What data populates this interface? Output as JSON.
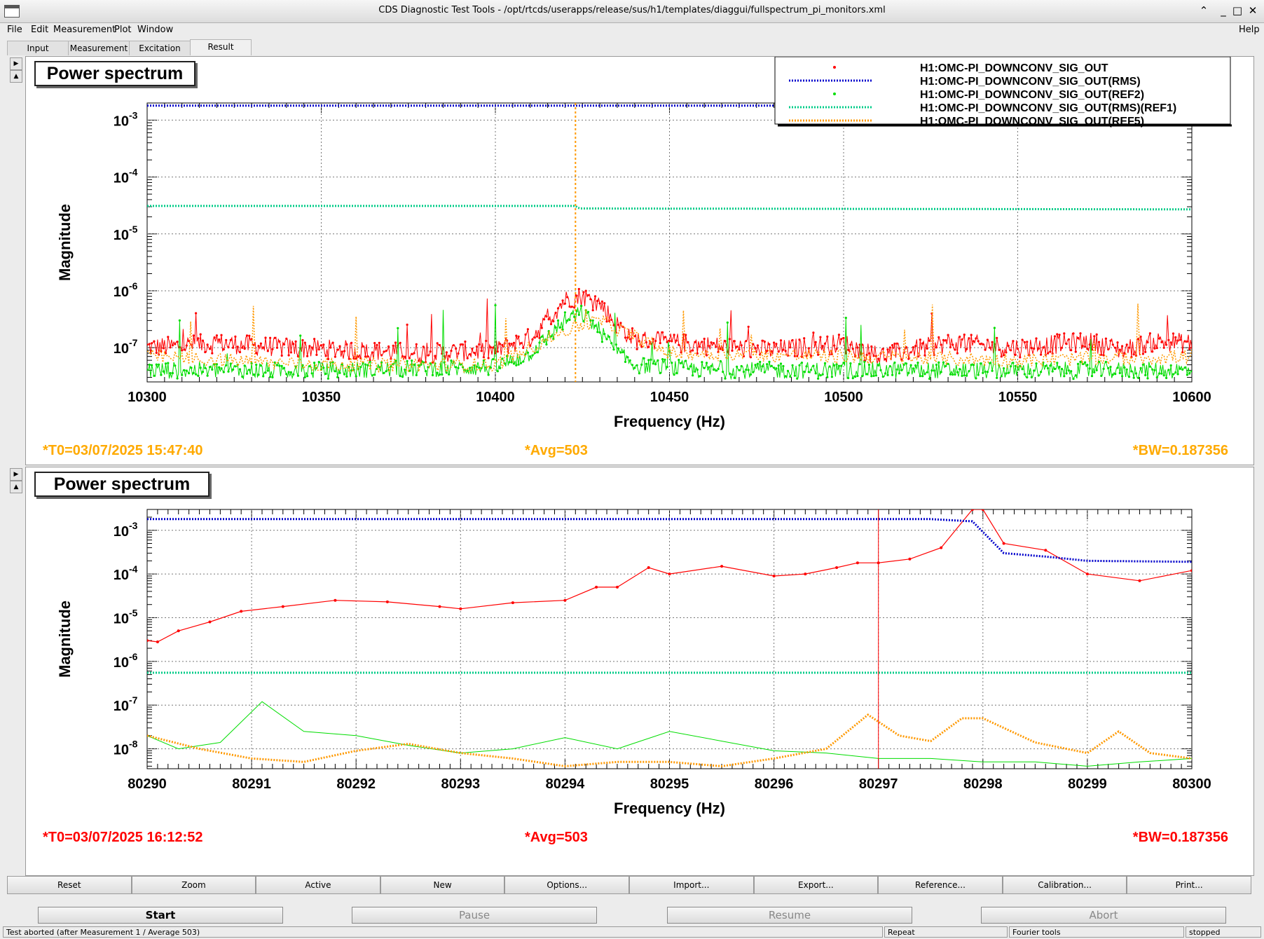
{
  "window": {
    "title": "CDS Diagnostic Test Tools - /opt/rtcds/userapps/release/sus/h1/templates/diaggui/fullspectrum_pi_monitors.xml"
  },
  "menu": {
    "file": "File",
    "edit": "Edit",
    "measurement": "Measurement",
    "plot": "Plot",
    "window": "Window",
    "help": "Help"
  },
  "tabs": [
    "Input",
    "Measurement",
    "Excitation",
    "Result"
  ],
  "active_tab": "Result",
  "legend": [
    {
      "name": "H1:OMC-PI_DOWNCONV_SIG_OUT",
      "color": "#ff0000",
      "style": "markers"
    },
    {
      "name": "H1:OMC-PI_DOWNCONV_SIG_OUT(RMS)",
      "color": "#0000cc",
      "style": "dotted"
    },
    {
      "name": "H1:OMC-PI_DOWNCONV_SIG_OUT(REF2)",
      "color": "#00dd00",
      "style": "markers"
    },
    {
      "name": "H1:OMC-PI_DOWNCONV_SIG_OUT(RMS)(REF1)",
      "color": "#00cc88",
      "style": "dotted"
    },
    {
      "name": "H1:OMC-PI_DOWNCONV_SIG_OUT(REF5)",
      "color": "#ff9900",
      "style": "dotted"
    }
  ],
  "plots": [
    {
      "title": "Power spectrum",
      "ylabel": "Magnitude",
      "xlabel": "Frequency (Hz)",
      "xticks": [
        "10300",
        "10350",
        "10400",
        "10450",
        "10500",
        "10550",
        "10600"
      ],
      "yticks": [
        {
          "base": "10",
          "exp": "-3"
        },
        {
          "base": "10",
          "exp": "-4"
        },
        {
          "base": "10",
          "exp": "-5"
        },
        {
          "base": "10",
          "exp": "-6"
        },
        {
          "base": "10",
          "exp": "-7"
        }
      ],
      "t0": "*T0=03/07/2025 15:47:40",
      "avg": "*Avg=503",
      "bw": "*BW=0.187356",
      "info_color": "#ffaa00"
    },
    {
      "title": "Power spectrum",
      "ylabel": "Magnitude",
      "xlabel": "Frequency (Hz)",
      "xticks": [
        "80290",
        "80291",
        "80292",
        "80293",
        "80294",
        "80295",
        "80296",
        "80297",
        "80298",
        "80299",
        "80300"
      ],
      "yticks": [
        {
          "base": "10",
          "exp": "-3"
        },
        {
          "base": "10",
          "exp": "-4"
        },
        {
          "base": "10",
          "exp": "-5"
        },
        {
          "base": "10",
          "exp": "-6"
        },
        {
          "base": "10",
          "exp": "-7"
        },
        {
          "base": "10",
          "exp": "-8"
        }
      ],
      "t0": "*T0=03/07/2025 16:12:52",
      "avg": "*Avg=503",
      "bw": "*BW=0.187356",
      "info_color": "#ff0000"
    }
  ],
  "chart_data": [
    {
      "type": "line",
      "title": "Power spectrum",
      "xlabel": "Frequency (Hz)",
      "ylabel": "Magnitude",
      "xlim": [
        10300,
        10600
      ],
      "ylim": [
        2.5e-08,
        0.002
      ],
      "yscale": "log",
      "grid": true,
      "legend_position": "top-right",
      "series": [
        {
          "name": "H1:OMC-PI_DOWNCONV_SIG_OUT",
          "color": "#ff0000",
          "x": [
            10300,
            10320,
            10340,
            10360,
            10380,
            10400,
            10410,
            10415,
            10420,
            10425,
            10430,
            10435,
            10440,
            10460,
            10480,
            10500,
            10510,
            10530,
            10550,
            10570,
            10580,
            10590,
            10600
          ],
          "y": [
            1e-07,
            1.2e-07,
            1e-07,
            9e-08,
            8e-08,
            9e-08,
            1.5e-07,
            3e-07,
            7e-07,
            8e-07,
            6e-07,
            2.5e-07,
            1.4e-07,
            1.1e-07,
            9e-08,
            1.2e-07,
            7e-08,
            1.2e-07,
            1e-07,
            1.3e-07,
            9e-08,
            1.3e-07,
            1.2e-07
          ]
        },
        {
          "name": "H1:OMC-PI_DOWNCONV_SIG_OUT(RMS)",
          "color": "#0000cc",
          "x": [
            10300,
            10600
          ],
          "y": [
            0.0018,
            0.0018
          ]
        },
        {
          "name": "H1:OMC-PI_DOWNCONV_SIG_OUT(REF2)",
          "color": "#00dd00",
          "x": [
            10300,
            10350,
            10400,
            10410,
            10415,
            10420,
            10425,
            10430,
            10435,
            10440,
            10460,
            10500,
            10550,
            10600
          ],
          "y": [
            4e-08,
            4e-08,
            4.5e-08,
            8e-08,
            1.5e-07,
            3e-07,
            4e-07,
            2e-07,
            8e-08,
            5e-08,
            4e-08,
            4e-08,
            4e-08,
            4e-08
          ]
        },
        {
          "name": "H1:OMC-PI_DOWNCONV_SIG_OUT(RMS)(REF1)",
          "color": "#00cc88",
          "x": [
            10300,
            10423,
            10424,
            10600
          ],
          "y": [
            3.1e-05,
            3.1e-05,
            2.8e-05,
            2.7e-05
          ]
        },
        {
          "name": "H1:OMC-PI_DOWNCONV_SIG_OUT(REF5)",
          "color": "#ff9900",
          "x": [
            10300,
            10350,
            10400,
            10420,
            10430,
            10450,
            10500,
            10550,
            10600
          ],
          "y": [
            7e-08,
            5e-08,
            5e-08,
            2e-07,
            3e-07,
            8e-08,
            7e-08,
            6e-08,
            7e-08
          ]
        }
      ]
    },
    {
      "type": "line",
      "title": "Power spectrum",
      "xlabel": "Frequency (Hz)",
      "ylabel": "Magnitude",
      "xlim": [
        80290,
        80300
      ],
      "ylim": [
        3.5e-09,
        0.003
      ],
      "yscale": "log",
      "grid": true,
      "series": [
        {
          "name": "H1:OMC-PI_DOWNCONV_SIG_OUT",
          "color": "#ff0000",
          "x": [
            80290,
            80290.1,
            80290.3,
            80290.6,
            80290.9,
            80291.3,
            80291.8,
            80292.3,
            80292.8,
            80293.0,
            80293.5,
            80294.0,
            80294.3,
            80294.5,
            80294.8,
            80295.0,
            80295.5,
            80296.0,
            80296.3,
            80296.6,
            80296.8,
            80297.0,
            80297.3,
            80297.6,
            80297.9,
            80298.0,
            80298.2,
            80298.6,
            80299.0,
            80299.5,
            80300.0
          ],
          "y": [
            3e-06,
            2.8e-06,
            5e-06,
            8e-06,
            1.4e-05,
            1.8e-05,
            2.5e-05,
            2.3e-05,
            1.8e-05,
            1.6e-05,
            2.2e-05,
            2.5e-05,
            5e-05,
            5e-05,
            0.00014,
            0.0001,
            0.00015,
            9e-05,
            0.0001,
            0.00014,
            0.00018,
            0.00018,
            0.00022,
            0.0004,
            0.003,
            0.003,
            0.0005,
            0.00035,
            0.0001,
            7e-05,
            0.00012
          ]
        },
        {
          "name": "H1:OMC-PI_DOWNCONV_SIG_OUT(RMS)",
          "color": "#0000cc",
          "x": [
            80290,
            80297.5,
            80297.9,
            80298.2,
            80298.6,
            80299.0,
            80300.0
          ],
          "y": [
            0.0018,
            0.0018,
            0.0016,
            0.0003,
            0.00025,
            0.0002,
            0.00019
          ]
        },
        {
          "name": "H1:OMC-PI_DOWNCONV_SIG_OUT(REF2)",
          "color": "#00dd00",
          "x": [
            80290,
            80290.3,
            80290.7,
            80291.1,
            80291.5,
            80292.0,
            80292.5,
            80293.0,
            80293.5,
            80294.0,
            80294.5,
            80295.0,
            80295.5,
            80296.0,
            80296.5,
            80297.0,
            80297.5,
            80298.0,
            80298.5,
            80299.0,
            80299.5,
            80300.0
          ],
          "y": [
            2e-08,
            1e-08,
            1.4e-08,
            1.2e-07,
            2.5e-08,
            2e-08,
            1.2e-08,
            8e-09,
            1e-08,
            1.8e-08,
            1e-08,
            2.5e-08,
            1.5e-08,
            9e-09,
            8e-09,
            6e-09,
            6e-09,
            5e-09,
            5e-09,
            4e-09,
            5e-09,
            6e-09
          ]
        },
        {
          "name": "H1:OMC-PI_DOWNCONV_SIG_OUT(RMS)(REF1)",
          "color": "#00cc88",
          "x": [
            80290,
            80300
          ],
          "y": [
            5.5e-07,
            5.5e-07
          ]
        },
        {
          "name": "H1:OMC-PI_DOWNCONV_SIG_OUT(REF5)",
          "color": "#ff9900",
          "x": [
            80290,
            80290.5,
            80291.0,
            80291.5,
            80292.0,
            80292.5,
            80293.0,
            80293.5,
            80294.0,
            80294.5,
            80295.0,
            80295.5,
            80296.0,
            80296.5,
            80296.9,
            80297.2,
            80297.5,
            80297.8,
            80298.0,
            80298.5,
            80299.0,
            80299.3,
            80299.6,
            80300.0
          ],
          "y": [
            2e-08,
            1e-08,
            6e-09,
            5e-09,
            9e-09,
            1.3e-08,
            8e-09,
            6e-09,
            4e-09,
            5e-09,
            5e-09,
            4e-09,
            6e-09,
            1e-08,
            6e-08,
            2e-08,
            1.5e-08,
            5e-08,
            5e-08,
            1.4e-08,
            8e-09,
            2.5e-08,
            8e-09,
            6e-09
          ]
        }
      ],
      "cursor_x": 80297
    }
  ],
  "toolbar": [
    "Reset",
    "Zoom",
    "Active",
    "New",
    "Options...",
    "Import...",
    "Export...",
    "Reference...",
    "Calibration...",
    "Print..."
  ],
  "actions": {
    "start": "Start",
    "pause": "Pause",
    "resume": "Resume",
    "abort": "Abort"
  },
  "status": {
    "message": "Test aborted (after Measurement 1 / Average 503)",
    "mode": "Repeat",
    "tool": "Fourier tools",
    "state": "stopped"
  }
}
